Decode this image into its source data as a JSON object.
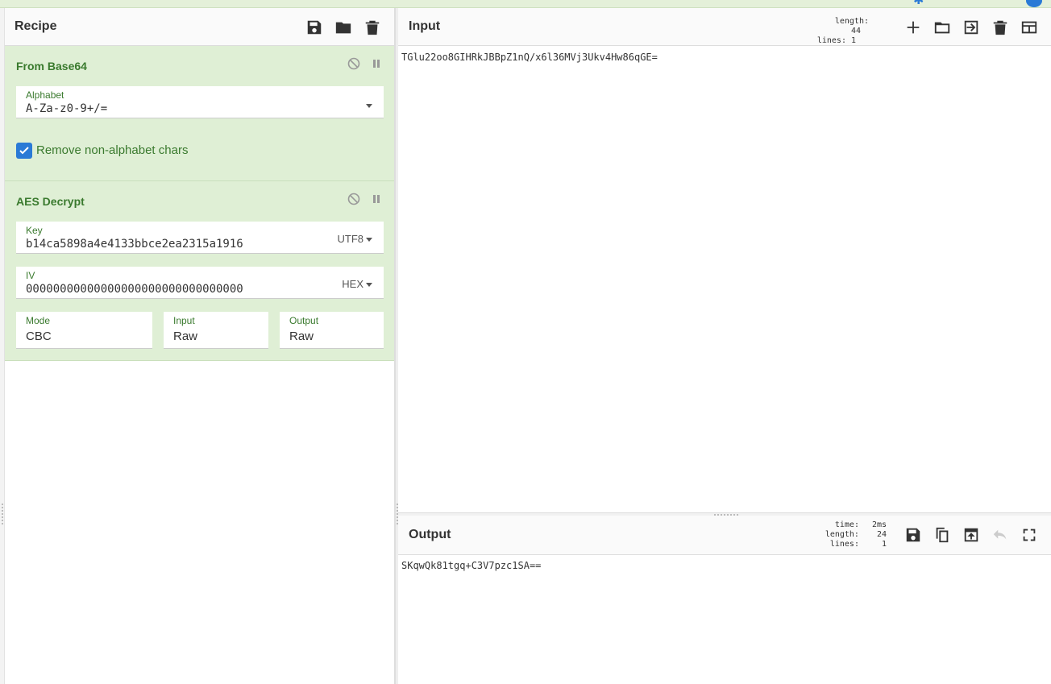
{
  "recipe": {
    "title": "Recipe",
    "operations": [
      {
        "name": "From Base64",
        "alphabet_label": "Alphabet",
        "alphabet_value": "A-Za-z0-9+/=",
        "checkbox_label": "Remove non-alphabet chars",
        "checkbox_checked": true
      },
      {
        "name": "AES Decrypt",
        "key_label": "Key",
        "key_value": "b14ca5898a4e4133bbce2ea2315a1916",
        "key_encoding": "UTF8",
        "iv_label": "IV",
        "iv_value": "00000000000000000000000000000000",
        "iv_encoding": "HEX",
        "mode_label": "Mode",
        "mode_value": "CBC",
        "input_label": "Input",
        "input_value": "Raw",
        "output_label": "Output",
        "output_value": "Raw"
      }
    ]
  },
  "input": {
    "title": "Input",
    "length_label": "length:",
    "length_value": "44",
    "lines_label": "lines:",
    "lines_value": "1",
    "text": "TGlu22oo8GIHRkJBBpZ1nQ/x6l36MVj3Ukv4Hw86qGE="
  },
  "output": {
    "title": "Output",
    "time_label": "time:",
    "time_value": "2ms",
    "length_label": "length:",
    "length_value": "24",
    "lines_label": "lines:",
    "lines_value": "1",
    "text": "SKqwQk81tgq+C3V7pzc1SA=="
  },
  "colors": {
    "op_background": "#dfefd5",
    "op_title": "#3a7a2e",
    "accent_blue": "#2a7ad6"
  }
}
